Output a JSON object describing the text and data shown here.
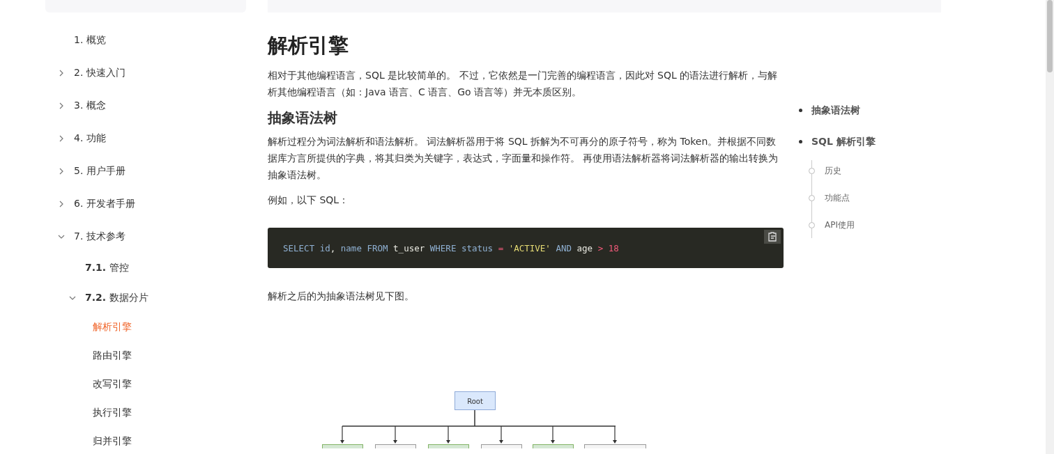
{
  "sidebar": {
    "items": [
      {
        "label": "1. 概览"
      },
      {
        "label": "2. 快速入门",
        "expanded": false
      },
      {
        "label": "3. 概念",
        "expanded": false
      },
      {
        "label": "4. 功能",
        "expanded": false
      },
      {
        "label": "5. 用户手册",
        "expanded": false
      },
      {
        "label": "6. 开发者手册",
        "expanded": false
      },
      {
        "label": "7. 技术参考",
        "expanded": true,
        "children": [
          {
            "number": "7.1.",
            "label": "管控"
          },
          {
            "number": "7.2.",
            "label": "数据分片",
            "expanded": true,
            "children": [
              {
                "label": "解析引擎",
                "selected": true
              },
              {
                "label": "路由引擎",
                "selected": false
              },
              {
                "label": "改写引擎",
                "selected": false
              },
              {
                "label": "执行引擎",
                "selected": false
              },
              {
                "label": "归并引擎",
                "selected": false
              }
            ]
          }
        ]
      }
    ]
  },
  "article": {
    "title": "解析引擎",
    "intro": "相对于其他编程语言，SQL 是比较简单的。 不过，它依然是一门完善的编程语言，因此对 SQL 的语法进行解析，与解析其他编程语言（如：Java 语言、C 语言、Go 语言等）并无本质区别。",
    "section_title": "抽象语法树",
    "paragraphs": [
      "解析过程分为词法解析和语法解析。 词法解析器用于将 SQL 拆解为不可再分的原子符号，称为 Token。并根据不同数据库方言所提供的字典，将其归类为关键字，表达式，字面量和操作符。 再使用语法解析器将词法解析器的输出转换为抽象语法树。",
      "例如，以下 SQL："
    ],
    "code": {
      "tokens": [
        {
          "text": "SELECT ",
          "kind": "keyword"
        },
        {
          "text": "id",
          "kind": "ident"
        },
        {
          "text": ", ",
          "kind": "plain"
        },
        {
          "text": "name ",
          "kind": "ident"
        },
        {
          "text": "FROM ",
          "kind": "keyword"
        },
        {
          "text": "t_user ",
          "kind": "plain"
        },
        {
          "text": "WHERE ",
          "kind": "keyword"
        },
        {
          "text": "status ",
          "kind": "ident"
        },
        {
          "text": "= ",
          "kind": "operator"
        },
        {
          "text": "'ACTIVE' ",
          "kind": "string"
        },
        {
          "text": "AND ",
          "kind": "keyword"
        },
        {
          "text": "age ",
          "kind": "plain"
        },
        {
          "text": "> ",
          "kind": "operator"
        },
        {
          "text": "18",
          "kind": "number"
        }
      ]
    },
    "after_code": "解析之后的为抽象语法树见下图。",
    "diagram": {
      "root": "Root",
      "children": [
        {
          "highlighted": true
        },
        {
          "highlighted": false
        },
        {
          "highlighted": true
        },
        {
          "highlighted": false
        },
        {
          "highlighted": true
        },
        {
          "highlighted": false
        }
      ]
    }
  },
  "toc": {
    "items": [
      {
        "label": "抽象语法树"
      },
      {
        "label": "SQL 解析引擎",
        "children": [
          {
            "label": "历史"
          },
          {
            "label": "功能点"
          },
          {
            "label": "API使用"
          }
        ]
      }
    ]
  }
}
